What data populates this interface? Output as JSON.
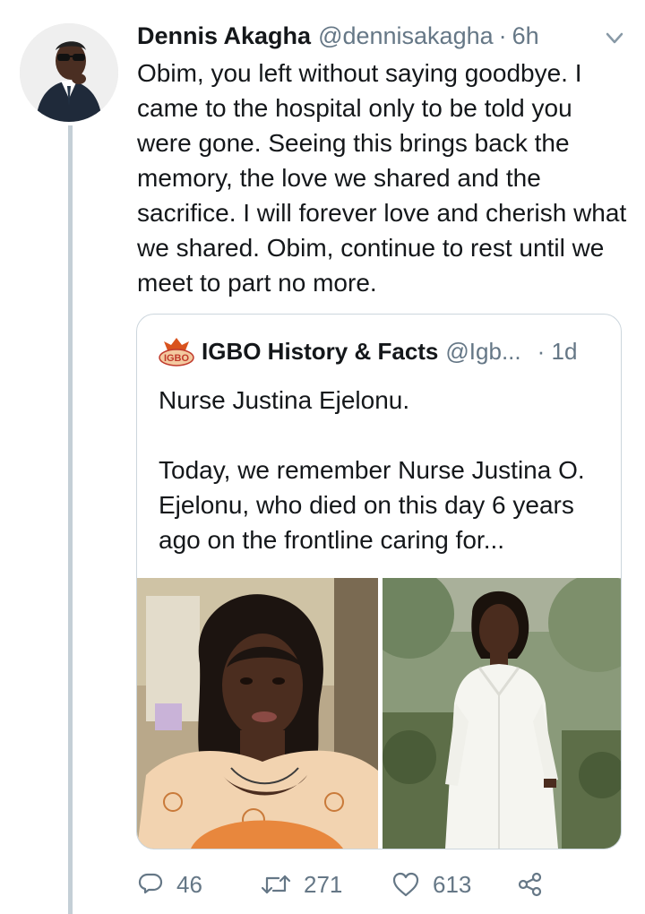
{
  "tweet": {
    "author_name": "Dennis Akagha",
    "author_handle": "@dennisakagha",
    "separator": "·",
    "time": "6h",
    "text": "Obim, you left without saying goodbye. I came to the hospital only to be told you were gone. Seeing this brings back the memory, the love we shared and the sacrifice. I will forever love and cherish what we shared. Obim, continue to rest until we meet to part no more."
  },
  "quoted_tweet": {
    "logo_text": "IGBO",
    "author_name": "IGBO History & Facts",
    "author_handle": "@Igb...",
    "time": "· 1d",
    "text": "Nurse Justina Ejelonu.\n\nToday, we remember Nurse Justina O. Ejelonu, who died on this day 6 years ago on the frontline caring for..."
  },
  "actions": {
    "replies": "46",
    "retweets": "271",
    "likes": "613"
  },
  "icons": [
    "chevron-down-icon",
    "reply-icon",
    "retweet-icon",
    "like-icon",
    "share-icon"
  ],
  "colors": {
    "secondary_text": "#657786",
    "border": "#ccd6dd",
    "thread_line": "#c4cfd6"
  }
}
